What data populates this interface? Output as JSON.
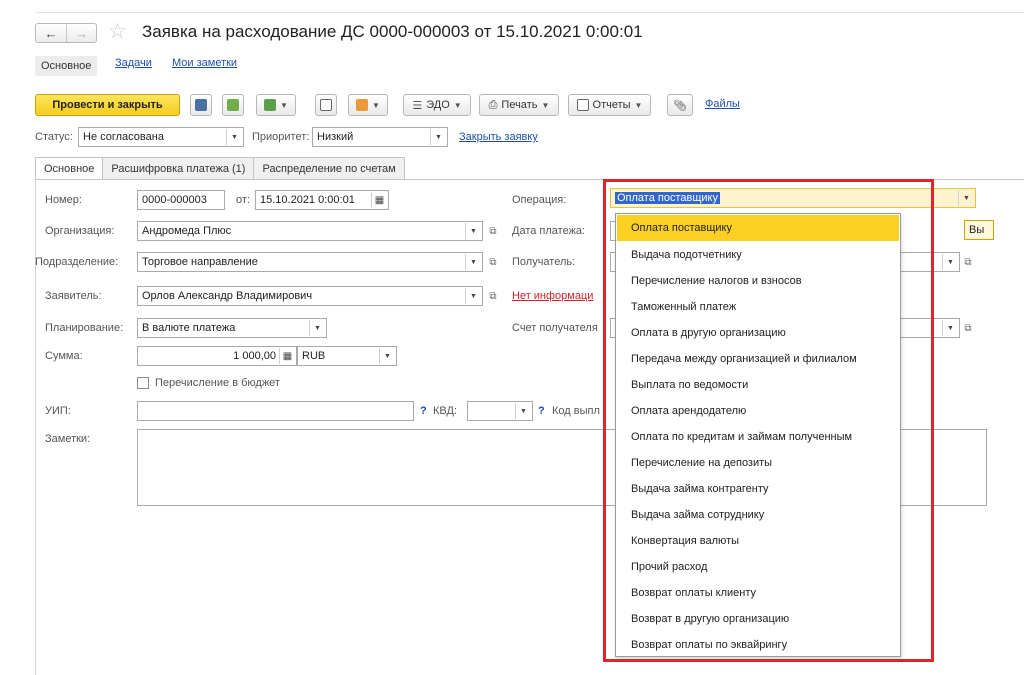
{
  "window": {
    "title": "Заявка на расходование ДС 0000-000003 от 15.10.2021 0:00:01",
    "nav_back": "←",
    "nav_forward": "→"
  },
  "sections": {
    "main": "Основное",
    "tasks": "Задачи",
    "notes": "Мои заметки"
  },
  "toolbar": {
    "post_close": "Провести и закрыть",
    "edo": "ЭДО",
    "print": "Печать",
    "reports": "Отчеты",
    "files": "Файлы"
  },
  "status_row": {
    "status_label": "Статус:",
    "status_value": "Не согласована",
    "priority_label": "Приоритет:",
    "priority_value": "Низкий",
    "close_request": "Закрыть заявку"
  },
  "tabs": [
    "Основное",
    "Расшифровка платежа (1)",
    "Распределение по счетам"
  ],
  "form": {
    "number_label": "Номер:",
    "number_value": "0000-000003",
    "date_from_label": "от:",
    "date_value": "15.10.2021  0:00:01",
    "org_label": "Организация:",
    "org_value": "Андромеда Плюс",
    "dept_label": "Подразделение:",
    "dept_value": "Торговое направление",
    "applicant_label": "Заявитель:",
    "applicant_value": "Орлов Александр Владимирович",
    "planning_label": "Планирование:",
    "planning_value": "В валюте платежа",
    "sum_label": "Сумма:",
    "sum_value": "1 000,00",
    "currency_value": "RUB",
    "budget_checkbox": "Перечисление в бюджет",
    "uip_label": "УИП:",
    "kvd_label": "КВД:",
    "q_mark": "?",
    "pay_code_label": "Код выпл",
    "notes_label": "Заметки:",
    "operation_label": "Операция:",
    "operation_value": "Оплата поставщику",
    "pay_date_label": "Дата платежа:",
    "recipient_label": "Получатель:",
    "no_info_link": "Нет информаци",
    "recipient_account_label": "Счет получателя",
    "right_cut_button": "Вы"
  },
  "operation_dropdown": [
    "Оплата поставщику",
    "Выдача подотчетнику",
    "Перечисление налогов и взносов",
    "Таможенный платеж",
    "Оплата в другую организацию",
    "Передача между организацией и филиалом",
    "Выплата по ведомости",
    "Оплата арендодателю",
    "Оплата по кредитам и займам полученным",
    "Перечисление на депозиты",
    "Выдача займа контрагенту",
    "Выдача займа сотруднику",
    "Конвертация валюты",
    "Прочий расход",
    "Возврат оплаты клиенту",
    "Возврат в другую организацию",
    "Возврат оплаты по эквайрингу"
  ],
  "colors": {
    "primary_button": "#f5cd1e",
    "selection": "#fcd023",
    "highlight_box": "#e2232b",
    "link": "#1d4fa8"
  }
}
